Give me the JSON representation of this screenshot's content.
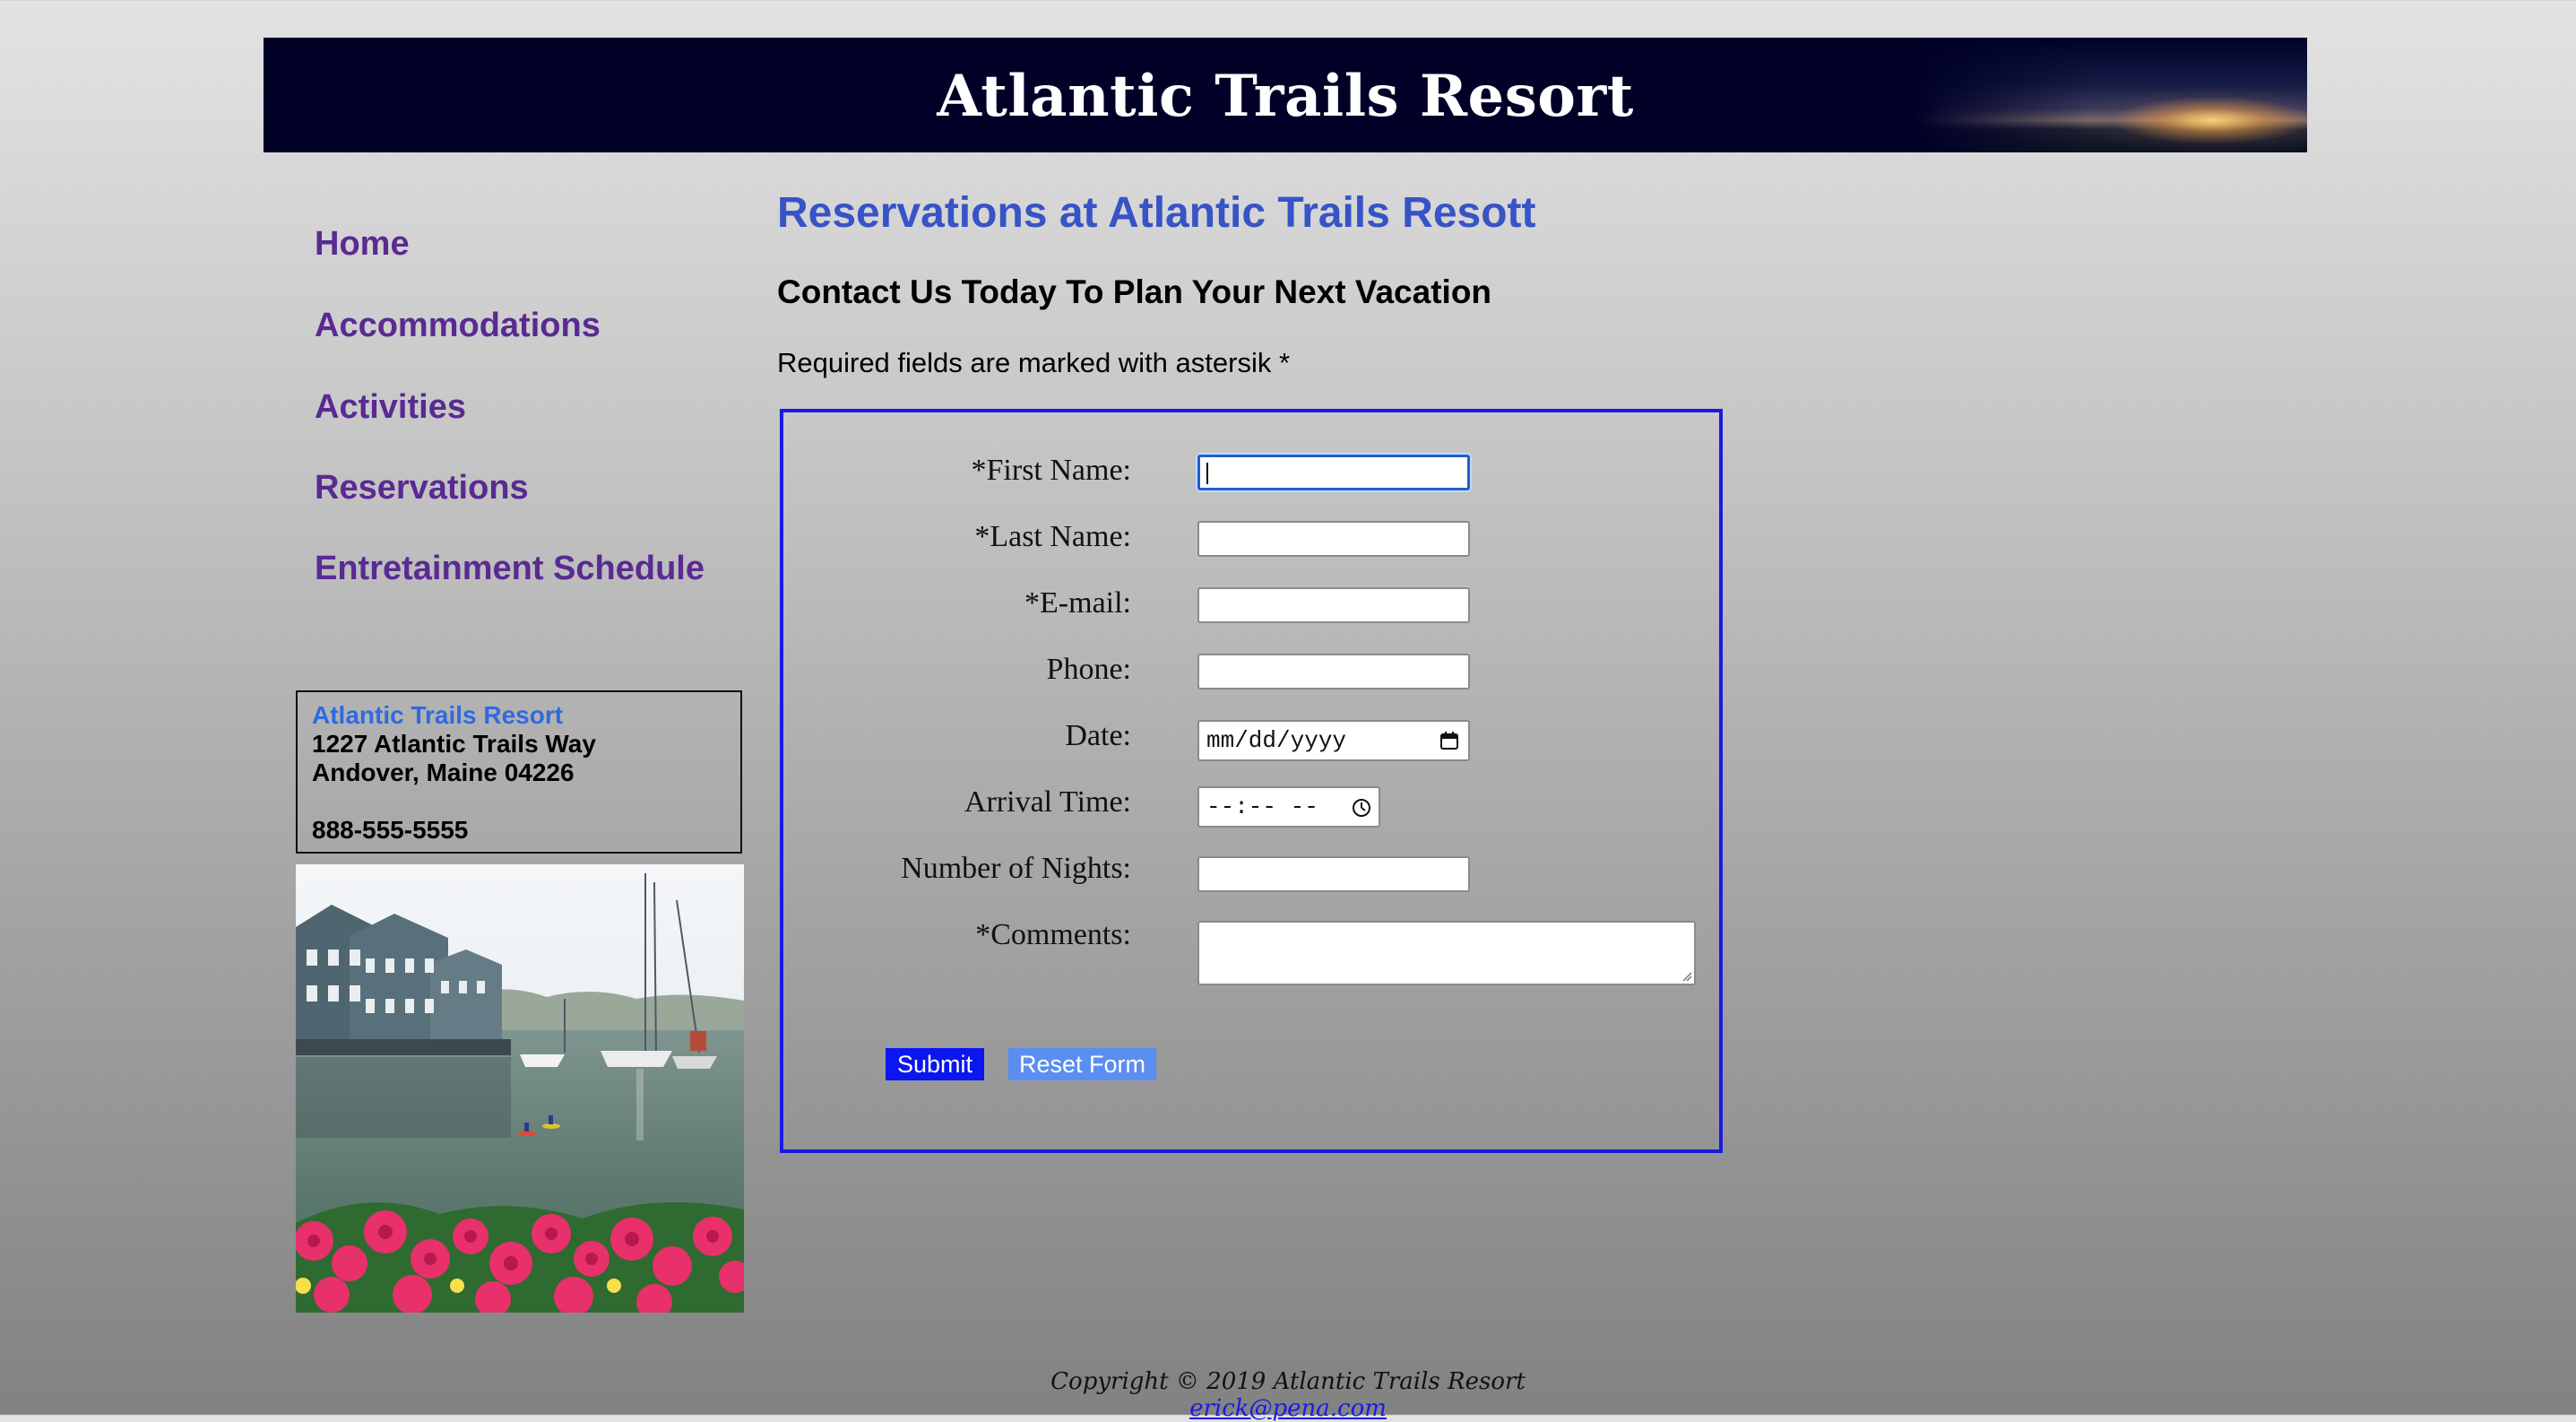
{
  "header": {
    "title": "Atlantic Trails Resort"
  },
  "nav": {
    "items": [
      {
        "label": "Home"
      },
      {
        "label": "Accommodations"
      },
      {
        "label": "Activities"
      },
      {
        "label": "Reservations"
      },
      {
        "label": "Entretainment Schedule"
      }
    ]
  },
  "address": {
    "name": "Atlantic Trails Resort",
    "street": "1227 Atlantic Trails Way",
    "city": "Andover, Maine 04226",
    "phone": "888-555-5555"
  },
  "main": {
    "title": "Reservations at Atlantic Trails Resott",
    "subtitle": "Contact Us Today To Plan Your Next Vacation",
    "required_note": "Required fields are marked with astersik *"
  },
  "form": {
    "first_name_label": "*First Name:",
    "first_name_value": "",
    "last_name_label": "*Last Name:",
    "last_name_value": "",
    "email_label": "*E-mail:",
    "email_value": "",
    "phone_label": "Phone:",
    "phone_value": "",
    "date_label": "Date:",
    "date_placeholder": "mm/dd/yyyy",
    "arrival_label": "Arrival Time:",
    "arrival_placeholder": "--:-- --",
    "nights_label": "Number of Nights:",
    "nights_value": "",
    "comments_label": "*Comments:",
    "comments_value": "",
    "submit_label": "Submit",
    "reset_label": "Reset Form"
  },
  "footer": {
    "copyright": "Copyright © 2019 Atlantic Trails Resort",
    "email": "erick@pena.com"
  },
  "colors": {
    "header_bg": "#010128",
    "nav_link": "#5a2a92",
    "title_blue": "#3753c6",
    "form_border": "#1a1ae0",
    "submit_bg": "#0b16f0",
    "reset_bg": "#5a8ef0"
  }
}
